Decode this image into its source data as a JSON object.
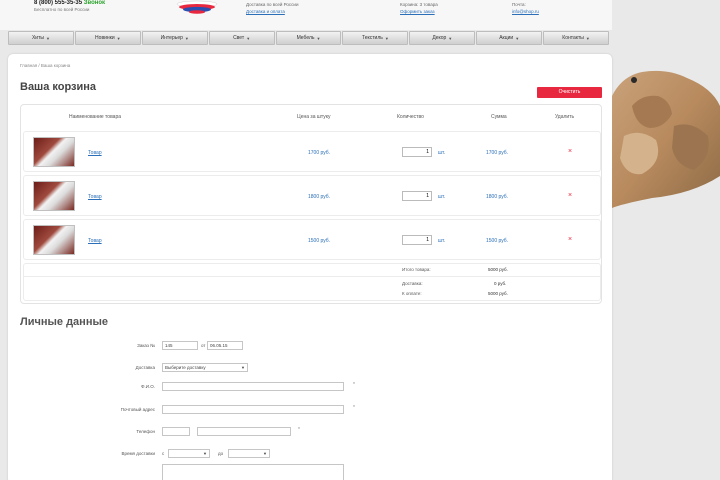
{
  "header": {
    "phone": "8 (800) 555-35-35",
    "callback": "Звонок",
    "phone_sub": "Бесплатно по всей России",
    "center_top": "Доставка по всей России",
    "center_link": "Доставка и оплата",
    "right1_top": "Корзина: 3 товара",
    "right1_link": "Оформить заказ",
    "right2_top": "Почта:",
    "right2_link": "info@shop.ru"
  },
  "nav": {
    "items": [
      "Хиты",
      "Новинки",
      "Интерьер",
      "Свет",
      "Мебель",
      "Текстиль",
      "Декор",
      "Акции",
      "Контакты"
    ]
  },
  "breadcrumb": "Главная / Ваша корзина",
  "page_title": "Ваша корзина",
  "clear_button": "Очистить",
  "cart": {
    "headers": {
      "name": "Наименование товара",
      "price": "Цена за штуку",
      "qty": "Количество",
      "sum": "Сумма",
      "delete": "Удалить"
    },
    "rows": [
      {
        "name": "Товар",
        "price": "1700 руб.",
        "qty": "1",
        "unit": "шт.",
        "sum": "1700 руб.",
        "delete": "×"
      },
      {
        "name": "Товар",
        "price": "1800 руб.",
        "qty": "1",
        "unit": "шт.",
        "sum": "1800 руб.",
        "delete": "×"
      },
      {
        "name": "Товар",
        "price": "1500 руб.",
        "qty": "1",
        "unit": "шт.",
        "sum": "1500 руб.",
        "delete": "×"
      }
    ],
    "totals": {
      "goods_label": "Итого товара:",
      "goods_value": "5000 руб.",
      "delivery_label": "Доставка:",
      "delivery_value": "0 руб.",
      "total_label": "К оплате:",
      "total_value": "5000 руб."
    }
  },
  "personal": {
    "title": "Личные данные",
    "fields": {
      "order_label": "Заказ №",
      "order_value": "145",
      "order_from": "от",
      "order_date": "06.05.15",
      "delivery_label": "Доставка",
      "delivery_value": "Выберите доставку",
      "fio_label": "Ф.И.О.",
      "address_label": "Почтовый адрес",
      "phone_label": "Телефон",
      "time_label": "Время доставки",
      "time_from": "с",
      "time_to": "до"
    },
    "required_mark": "*"
  },
  "colors": {
    "accent_red": "#e8283f",
    "link_blue": "#2a6fb8"
  },
  "icons": {
    "delete": "close-icon",
    "caret": "chevron-down-icon"
  }
}
